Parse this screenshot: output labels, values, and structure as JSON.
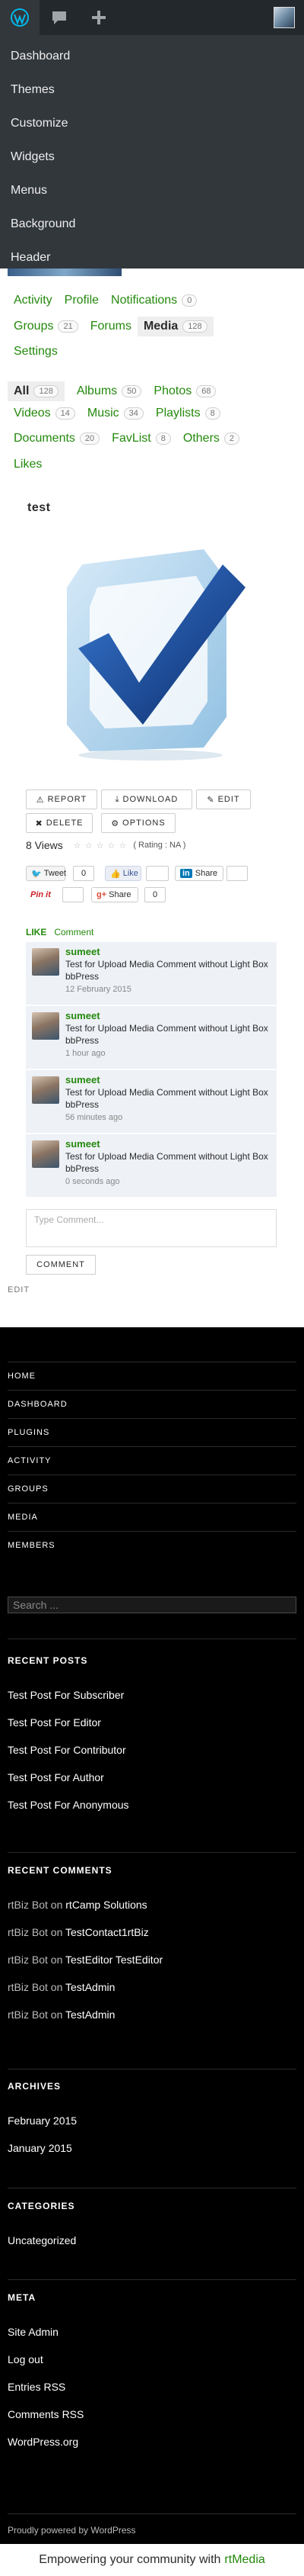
{
  "adminbar": {
    "icons": [
      "wordpress-icon",
      "comments-icon",
      "plus-icon",
      "avatar"
    ]
  },
  "dropdown": {
    "items": [
      "Dashboard",
      "Themes",
      "Customize",
      "Widgets",
      "Menus",
      "Background",
      "Header"
    ]
  },
  "profile_nav": {
    "items": [
      {
        "label": "Activity"
      },
      {
        "label": "Profile"
      },
      {
        "label": "Notifications",
        "count": "0"
      },
      {
        "label": "Groups",
        "count": "21"
      },
      {
        "label": "Forums"
      },
      {
        "label": "Media",
        "count": "128",
        "current": true
      },
      {
        "label": "Settings"
      }
    ]
  },
  "media_nav": {
    "items": [
      {
        "label": "All",
        "count": "128",
        "current": true
      },
      {
        "label": "Albums",
        "count": "50"
      },
      {
        "label": "Photos",
        "count": "68"
      },
      {
        "label": "Videos",
        "count": "14"
      },
      {
        "label": "Music",
        "count": "34"
      },
      {
        "label": "Playlists",
        "count": "8"
      },
      {
        "label": "Documents",
        "count": "20"
      },
      {
        "label": "FavList",
        "count": "8"
      },
      {
        "label": "Others",
        "count": "2"
      },
      {
        "label": "Likes"
      }
    ]
  },
  "media": {
    "title": "test",
    "buttons": [
      "REPORT",
      "DOWNLOAD",
      "EDIT",
      "DELETE",
      "OPTIONS"
    ],
    "views": "8 Views",
    "rating": "( Rating : NA )"
  },
  "share": {
    "tweet": "Tweet",
    "tweet_count": "0",
    "fb_like": "Like",
    "linkedin": "Share",
    "pinit": "Pin it",
    "gplus": "Share",
    "gplus_count": "0"
  },
  "actions": {
    "like": "LIKE",
    "comment": "Comment"
  },
  "comments": [
    {
      "author": "sumeet",
      "text": "Test for Upload Media Comment without Light Box bbPress",
      "time": "12 February 2015"
    },
    {
      "author": "sumeet",
      "text": "Test for Upload Media Comment without Light Box bbPress",
      "time": "1 hour ago"
    },
    {
      "author": "sumeet",
      "text": "Test for Upload Media Comment without Light Box bbPress",
      "time": "56 minutes ago"
    },
    {
      "author": "sumeet",
      "text": "Test for Upload Media Comment without Light Box bbPress",
      "time": "0 seconds ago"
    }
  ],
  "comment_form": {
    "placeholder": "Type Comment...",
    "submit": "COMMENT"
  },
  "edit_link": "EDIT",
  "footer": {
    "menu": [
      "HOME",
      "DASHBOARD",
      "PLUGINS",
      "ACTIVITY",
      "GROUPS",
      "MEDIA",
      "MEMBERS"
    ],
    "search_placeholder": "Search ...",
    "recent_posts": {
      "heading": "RECENT POSTS",
      "items": [
        "Test Post For Subscriber",
        "Test Post For Editor",
        "Test Post For Contributor",
        "Test Post For Author",
        "Test Post For Anonymous"
      ]
    },
    "recent_comments": {
      "heading": "RECENT COMMENTS",
      "items": [
        {
          "author": "rtBiz Bot",
          "on": "on",
          "post": "rtCamp Solutions"
        },
        {
          "author": "rtBiz Bot",
          "on": "on",
          "post": "TestContact1rtBiz"
        },
        {
          "author": "rtBiz Bot",
          "on": "on",
          "post": "TestEditor TestEditor"
        },
        {
          "author": "rtBiz Bot",
          "on": "on",
          "post": "TestAdmin"
        },
        {
          "author": "rtBiz Bot",
          "on": "on",
          "post": "TestAdmin"
        }
      ]
    },
    "archives": {
      "heading": "ARCHIVES",
      "items": [
        "February 2015",
        "January 2015"
      ]
    },
    "categories": {
      "heading": "CATEGORIES",
      "items": [
        "Uncategorized"
      ]
    },
    "meta": {
      "heading": "META",
      "items": [
        "Site Admin",
        "Log out",
        "Entries RSS",
        "Comments RSS",
        "WordPress.org"
      ]
    },
    "powered": "Proudly powered by WordPress"
  },
  "rtmedia_bar": {
    "text": "Empowering your community with",
    "brand": "rtMedia"
  },
  "colors": {
    "accent": "#24890d",
    "adminbar": "#23282d",
    "footer": "#000000"
  }
}
